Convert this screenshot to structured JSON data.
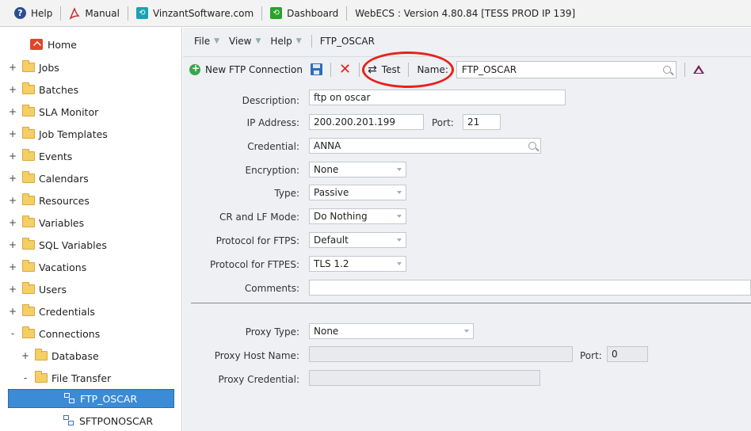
{
  "topbar": {
    "help": "Help",
    "manual": "Manual",
    "vinzant": "VinzantSoftware.com",
    "dashboard": "Dashboard",
    "version": "WebECS : Version 4.80.84 [TESS PROD IP 139]"
  },
  "sidebar": {
    "home": "Home",
    "items": [
      {
        "exp": "+",
        "label": "Jobs"
      },
      {
        "exp": "+",
        "label": "Batches"
      },
      {
        "exp": "+",
        "label": "SLA Monitor"
      },
      {
        "exp": "+",
        "label": "Job Templates"
      },
      {
        "exp": "+",
        "label": "Events"
      },
      {
        "exp": "+",
        "label": "Calendars"
      },
      {
        "exp": "+",
        "label": "Resources"
      },
      {
        "exp": "+",
        "label": "Variables"
      },
      {
        "exp": "+",
        "label": "SQL Variables"
      },
      {
        "exp": "+",
        "label": "Vacations"
      },
      {
        "exp": "+",
        "label": "Users"
      },
      {
        "exp": "+",
        "label": "Credentials"
      },
      {
        "exp": "-",
        "label": "Connections"
      }
    ],
    "database": {
      "exp": "+",
      "label": "Database"
    },
    "file_transfer": {
      "exp": "-",
      "label": "File Transfer"
    },
    "ftp_oscar": "FTP_OSCAR",
    "sftp_oscar": "SFTPONOSCAR"
  },
  "menubar": {
    "file": "File",
    "view": "View",
    "help": "Help",
    "current": "FTP_OSCAR"
  },
  "toolbar": {
    "new_ftp": "New FTP Connection",
    "test": "Test",
    "name_label": "Name:",
    "name_value": "FTP_OSCAR"
  },
  "form": {
    "description_label": "Description:",
    "description_value": "ftp on oscar",
    "ip_label": "IP Address:",
    "ip_value": "200.200.201.199",
    "port_label": "Port:",
    "port_value": "21",
    "credential_label": "Credential:",
    "credential_value": "ANNA",
    "encryption_label": "Encryption:",
    "encryption_value": "None",
    "type_label": "Type:",
    "type_value": "Passive",
    "crlf_label": "CR and LF Mode:",
    "crlf_value": "Do Nothing",
    "ftps_label": "Protocol for FTPS:",
    "ftps_value": "Default",
    "ftpes_label": "Protocol for FTPES:",
    "ftpes_value": "TLS 1.2",
    "comments_label": "Comments:",
    "comments_value": "",
    "proxy_type_label": "Proxy Type:",
    "proxy_type_value": "None",
    "proxy_host_label": "Proxy Host Name:",
    "proxy_host_value": "",
    "proxy_port_label": "Port:",
    "proxy_port_value": "0",
    "proxy_cred_label": "Proxy Credential:",
    "proxy_cred_value": ""
  },
  "colors": {
    "selection": "#3b8bd6",
    "annotation": "#e8211d",
    "panel": "#eef0f3"
  }
}
